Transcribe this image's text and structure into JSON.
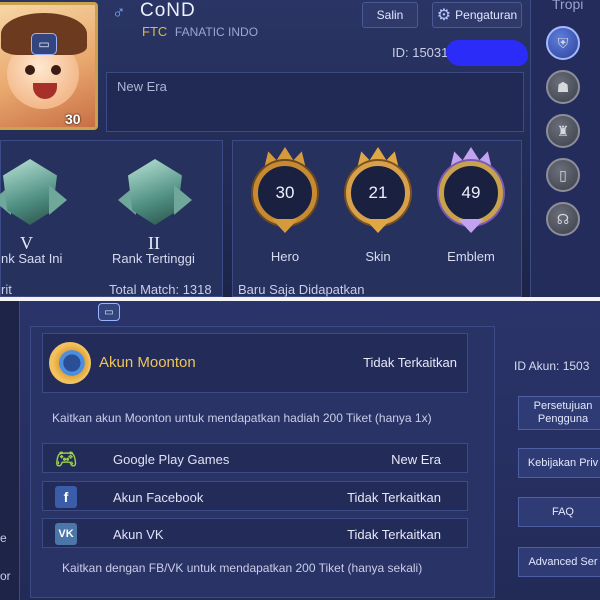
{
  "profile": {
    "gender_symbol": "♂",
    "name": "CoND",
    "squad_tag": "FTC",
    "squad_name": "FANATIC INDO",
    "level": "30",
    "id_label": "ID: 15031",
    "signature": "New Era",
    "copy_button": "Salin",
    "settings_button": "Pengaturan"
  },
  "side": {
    "title": "Tropi",
    "buttons": [
      "shield-icon",
      "mask-icon",
      "shirt-icon",
      "tablet-icon",
      "helmet-icon"
    ]
  },
  "rank": {
    "current_numeral": "V",
    "current_label": "nk Saat Ini",
    "highest_numeral": "II",
    "highest_label": "Rank Tertinggi",
    "footer_left": "rit",
    "total_match": "Total Match: 1318"
  },
  "collection": {
    "hero_count": "30",
    "hero_label": "Hero",
    "skin_count": "21",
    "skin_label": "Skin",
    "emblem_count": "49",
    "emblem_label": "Emblem",
    "recent": "Baru Saja Didapatkan"
  },
  "account": {
    "moonton_label": "Akun Moonton",
    "moonton_status": "Tidak Terkaitkan",
    "moonton_hint": "Kaitkan akun Moonton untuk mendapatkan hadiah 200 Tiket (hanya 1x)",
    "links": [
      {
        "icon": "gamepad-icon",
        "label": "Google Play Games",
        "status": "New Era"
      },
      {
        "icon": "facebook-icon",
        "label": "Akun Facebook",
        "status": "Tidak Terkaitkan"
      },
      {
        "icon": "vk-icon",
        "label": "Akun VK",
        "status": "Tidak Terkaitkan"
      }
    ],
    "fbvk_hint": "Kaitkan dengan FB/VK untuk mendapatkan 200 Tiket (hanya sekali)",
    "id_akun": "ID Akun: 1503"
  },
  "right_menu": {
    "agreement_line1": "Persetujuan",
    "agreement_line2": "Pengguna",
    "privacy": "Kebijakan Priv",
    "faq": "FAQ",
    "advanced": "Advanced Ser"
  },
  "edge": {
    "e": "e",
    "or": "or"
  },
  "colors": {
    "accent_gold": "#efc55a",
    "panel": "#27315e",
    "id_scribble": "#2b2cff"
  }
}
